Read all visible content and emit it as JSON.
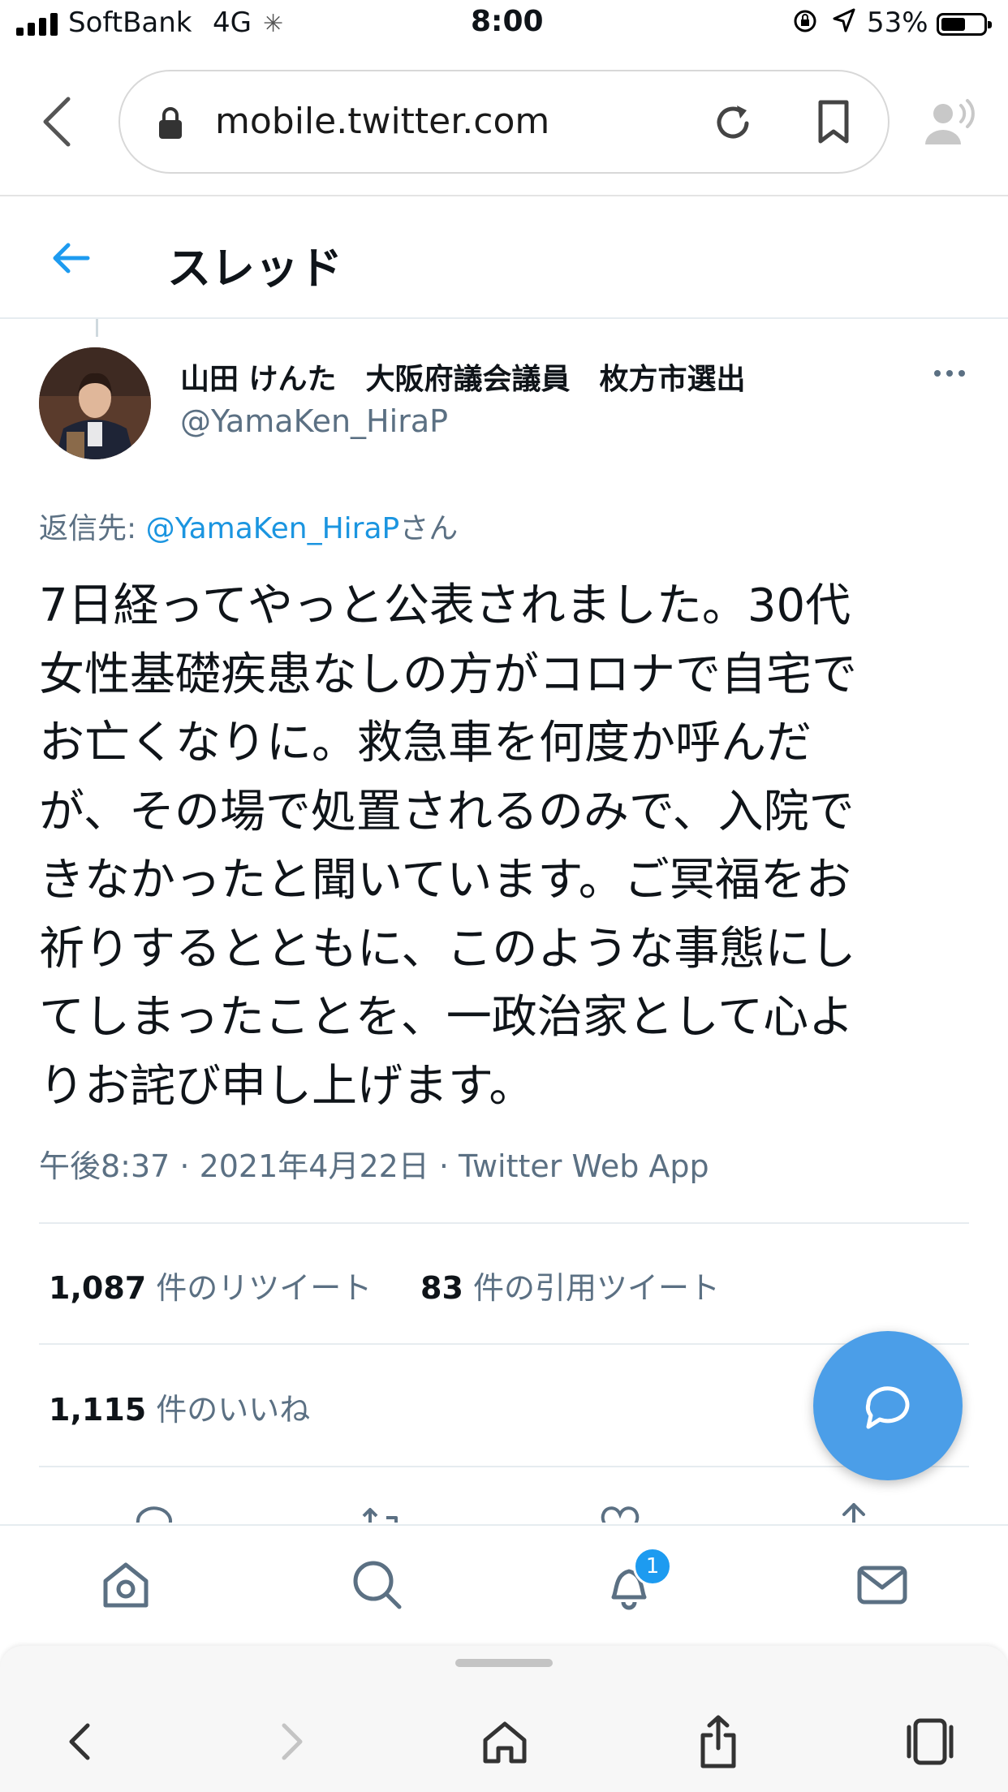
{
  "status_bar": {
    "carrier": "SoftBank",
    "network": "4G",
    "time": "8:00",
    "battery_percent": "53%",
    "battery_level": 0.53
  },
  "browser": {
    "url": "mobile.twitter.com",
    "icons": [
      "back-icon",
      "lock-icon",
      "reload-icon",
      "bookmark-icon",
      "text-to-speech-icon"
    ]
  },
  "header": {
    "title": "スレッド"
  },
  "tweet": {
    "author_name": "山田 けんた　大阪府議会議員　枚方市選出",
    "author_handle": "@YamaKen_HiraP",
    "reply_prefix": "返信先: ",
    "reply_mention": "@YamaKen_HiraP",
    "reply_suffix": "さん",
    "text_lines": [
      "7日経ってやっと公表されました。30代",
      "女性基礎疾患なしの方がコロナで自宅で",
      "お亡くなりに。救急車を何度か呼んだ",
      "が、その場で処置されるのみで、入院で",
      "きなかったと聞いています。ご冥福をお",
      "祈りするとともに、このような事態にし",
      "てしまったことを、一政治家として心よ",
      "りお詫び申し上げます。"
    ],
    "meta": "午後8:37 · 2021年4月22日 · Twitter Web App",
    "retweets_count": "1,087",
    "retweets_label": " 件のリツイート",
    "quotes_count": "83",
    "quotes_label": " 件の引用ツイート",
    "likes_count": "1,115",
    "likes_label": " 件のいいね"
  },
  "tabbar": {
    "items": [
      "home-icon",
      "search-icon",
      "notifications-icon",
      "messages-icon"
    ],
    "notification_badge": "1"
  },
  "colors": {
    "accent": "#1d9bf0",
    "fab": "#4b9ee8",
    "secondary_text": "#5b7083"
  }
}
